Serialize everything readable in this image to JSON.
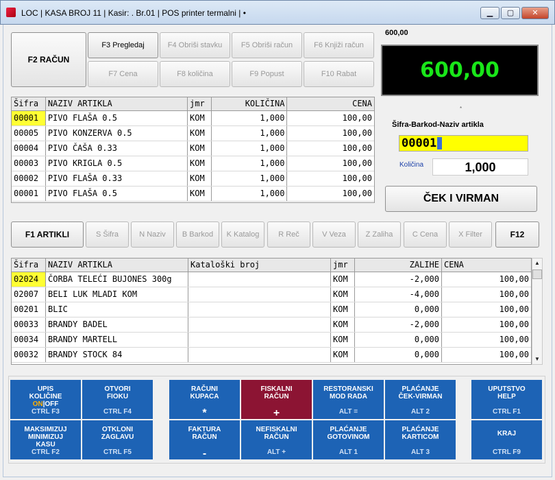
{
  "window": {
    "title": "LOC | KASA BROJ 11 | Kasir: . Br.01 | POS printer termalni |  •",
    "min": "▁",
    "max": "▢",
    "close": "✕"
  },
  "top_buttons": {
    "racun": "F2    RAČUN",
    "pregledaj": "F3    Pregledaj",
    "obrisi_stavku": "F4    Obriši stavku",
    "obrisi_racun": "F5    Obriši račun",
    "knjizi_racun": "F6    Knjiži račun",
    "cena": "F7    Cena",
    "kolicina": "F8    količina",
    "popust": "F9    Popust",
    "rabat": "F10    Rabat"
  },
  "display": {
    "small": "600,00",
    "amount": "600,00",
    "dot": "*"
  },
  "receipt_table": {
    "headers": [
      "Šifra",
      "NAZIV ARTIKLA",
      "jmr",
      "KOLIČINA",
      "CENA"
    ],
    "rows": [
      [
        "00001",
        "PIVO FLAŠA 0.5",
        "KOM",
        "1,000",
        "100,00"
      ],
      [
        "00005",
        "PIVO KONZERVA 0.5",
        "KOM",
        "1,000",
        "100,00"
      ],
      [
        "00004",
        "PIVO ČAŠA 0.33",
        "KOM",
        "1,000",
        "100,00"
      ],
      [
        "00003",
        "PIVO KRIGLA 0.5",
        "KOM",
        "1,000",
        "100,00"
      ],
      [
        "00002",
        "PIVO FLAŠA 0.33",
        "KOM",
        "1,000",
        "100,00"
      ],
      [
        "00001",
        "PIVO FLAŠA 0.5",
        "KOM",
        "1,000",
        "100,00"
      ]
    ]
  },
  "input_panel": {
    "search_label": "Šifra-Barkod-Naziv artikla",
    "search_value": "00001",
    "qty_label": "Količina",
    "qty_value": "1,000",
    "cek_button": "ČEK I VIRMAN"
  },
  "article_buttons": {
    "artikli": "F1    ARTIKLI",
    "sifra": "S  Šifra",
    "naziv": "N  Naziv",
    "barkod": "B  Barkod",
    "katalog": "K  Katalog",
    "rec": "R  Reč",
    "veza": "V  Veza",
    "zaliha": "Z  Zaliha",
    "cena": "C  Cena",
    "filter": "X  Filter",
    "f12": "F12"
  },
  "articles_table": {
    "headers": [
      "Šifra",
      "NAZIV ARTIKLA",
      "Kataloški broj",
      "jmr",
      "ZALIHE",
      "CENA"
    ],
    "rows": [
      [
        "02024",
        "ČORBA TELEĆI BUJONES 300g",
        "",
        "KOM",
        "-2,000",
        "100,00"
      ],
      [
        "02007",
        "BELI LUK MLADI KOM",
        "",
        "KOM",
        "-4,000",
        "100,00"
      ],
      [
        "00201",
        "BLIC",
        "",
        "KOM",
        "0,000",
        "100,00"
      ],
      [
        "00033",
        "BRANDY BADEL",
        "",
        "KOM",
        "-2,000",
        "100,00"
      ],
      [
        "00034",
        "BRANDY MARTELL",
        "",
        "KOM",
        "0,000",
        "100,00"
      ],
      [
        "00032",
        "BRANDY STOCK 84",
        "",
        "KOM",
        "0,000",
        "100,00"
      ]
    ]
  },
  "tiles": {
    "upis": {
      "l1": "UPIS",
      "l2": "KOLIČINE",
      "on": "ON",
      "sep": "|",
      "off": "OFF",
      "sub": "CTRL F3"
    },
    "otvori": {
      "l1": "OTVORI",
      "l2": "FIOKU",
      "sub": "CTRL   F4"
    },
    "racuni": {
      "l1": "RAČUNI",
      "l2": "KUPACA",
      "big": "*"
    },
    "fiskalni": {
      "l1": "FISKALNI",
      "l2": "RAČUN",
      "big": "+"
    },
    "restoranski": {
      "l1": "RESTORANSKI",
      "l2": "MOD RADA",
      "sub": "ALT  ="
    },
    "placanje_cek": {
      "l1": "PLAĆANJE",
      "l2": "ČEK-VIRMAN",
      "sub": "ALT   2"
    },
    "uputstvo": {
      "l1": "UPUTSTVO",
      "l2": "HELP",
      "sub": "CTRL  F1"
    },
    "maksimizuj": {
      "l1": "MAKSIMIZUJ",
      "l2": "MINIMIZUJ",
      "l3": "KASU",
      "sub": "CTRL  F2"
    },
    "otkloni": {
      "l1": "OTKLONI",
      "l2": "ZAGLAVU",
      "sub": "CTRL   F5"
    },
    "faktura": {
      "l1": "FAKTURA",
      "l2": "RAČUN",
      "big": "-"
    },
    "nefiskalni": {
      "l1": "NEFISKALNI",
      "l2": "RAČUN",
      "sub": "ALT  +"
    },
    "placanje_got": {
      "l1": "PLAĆANJE",
      "l2": "GOTOVINOM",
      "sub": "ALT   1"
    },
    "placanje_kart": {
      "l1": "PLAĆANJE",
      "l2": "KARTICOM",
      "sub": "ALT   3"
    },
    "kraj": {
      "l1": "KRAJ",
      "sub": "CTRL   F9"
    }
  },
  "colors": {
    "display_text": "#19e619",
    "tile_blue": "#1d63b5",
    "tile_red": "#8c1433",
    "highlight": "#ffff33"
  }
}
